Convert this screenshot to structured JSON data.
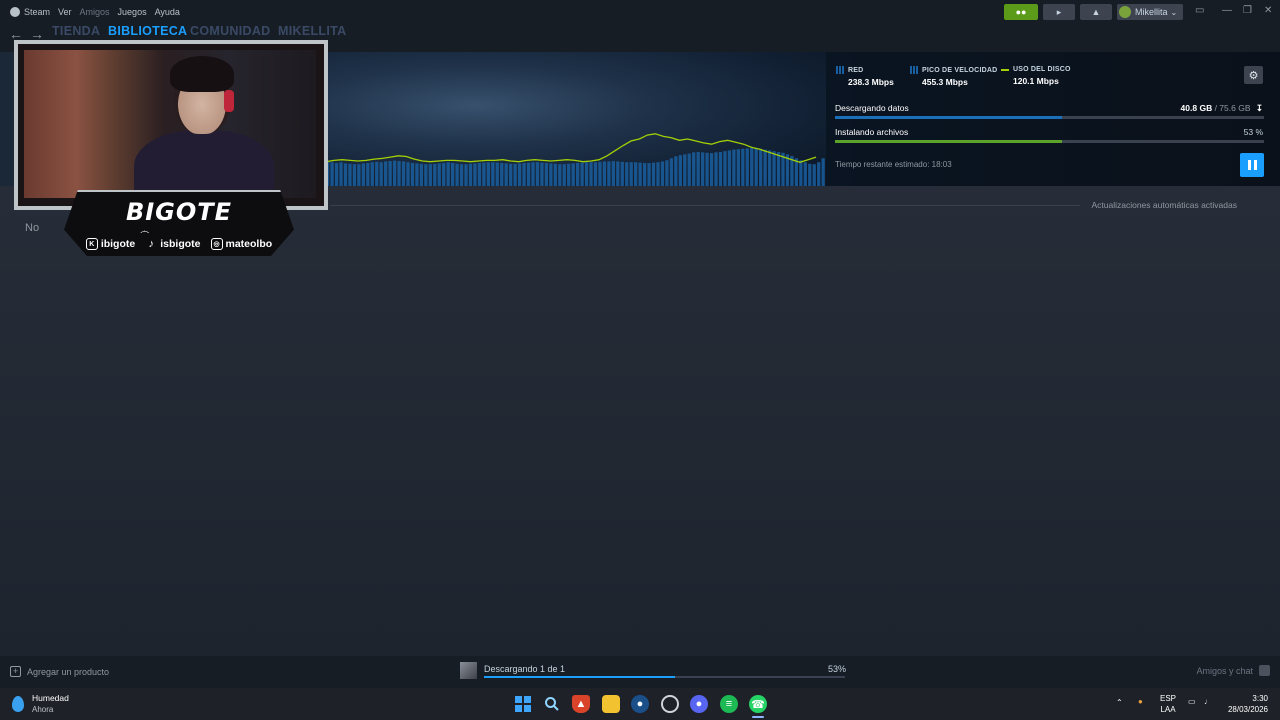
{
  "menubar": {
    "app": "Steam",
    "items": [
      "Ver",
      "Amigos",
      "Juegos",
      "Ayuda"
    ],
    "account_name": "Mikellita",
    "account_caret": "⌄"
  },
  "nav": {
    "back_arrow": "←",
    "forward_arrow": "→",
    "tabs": [
      "TIENDA",
      "BIBLIOTECA",
      "COMUNIDAD",
      "MIKELLITA"
    ],
    "active_tab": "BIBLIOTECA"
  },
  "downloads": {
    "stats": [
      {
        "label": "RED",
        "value": "238.3 Mbps",
        "legend": "bars"
      },
      {
        "label": "PICO DE VELOCIDAD",
        "value": "455.3 Mbps",
        "legend": "bars"
      },
      {
        "label": "USO DEL DISCO",
        "value": "120.1 Mbps",
        "legend": "line"
      }
    ],
    "downloading_label": "Descargando datos",
    "downloaded_amount": "40.8 GB",
    "total_amount": "/ 75.6 GB",
    "download_progress": 0.53,
    "installing_label": "Instalando archivos",
    "install_percent": "53 %",
    "install_progress": 0.53,
    "eta": "Tiempo restante estimado: 18:03",
    "auto_updates": "Actualizaciones automáticas activadas",
    "partial_text": "No",
    "graph": {
      "network_bars": [
        0.62,
        0.6,
        0.58,
        0.6,
        0.57,
        0.56,
        0.55,
        0.55,
        0.57,
        0.58,
        0.6,
        0.61,
        0.6,
        0.62,
        0.63,
        0.64,
        0.63,
        0.62,
        0.6,
        0.58,
        0.57,
        0.56,
        0.55,
        0.55,
        0.56,
        0.57,
        0.58,
        0.6,
        0.58,
        0.56,
        0.55,
        0.55,
        0.56,
        0.57,
        0.58,
        0.59,
        0.6,
        0.6,
        0.59,
        0.58,
        0.57,
        0.56,
        0.56,
        0.57,
        0.58,
        0.59,
        0.6,
        0.6,
        0.59,
        0.58,
        0.57,
        0.56,
        0.55,
        0.55,
        0.56,
        0.57,
        0.58,
        0.59,
        0.6,
        0.6,
        0.6,
        0.61,
        0.62,
        0.62,
        0.63,
        0.62,
        0.61,
        0.6,
        0.6,
        0.6,
        0.59,
        0.58,
        0.58,
        0.59,
        0.6,
        0.62,
        0.65,
        0.7,
        0.75,
        0.78,
        0.8,
        0.82,
        0.85,
        0.86,
        0.85,
        0.84,
        0.83,
        0.85,
        0.86,
        0.88,
        0.9,
        0.92,
        0.93,
        0.94,
        0.95,
        0.96,
        0.95,
        0.94,
        0.92,
        0.9,
        0.88,
        0.86,
        0.84,
        0.8,
        0.76,
        0.7,
        0.65,
        0.6,
        0.56,
        0.55,
        0.6,
        0.7
      ],
      "disk_line": [
        0.53,
        0.55,
        0.56,
        0.55,
        0.54,
        0.55,
        0.57,
        0.58,
        0.6,
        0.62,
        0.61,
        0.57,
        0.54,
        0.53,
        0.54,
        0.55,
        0.55,
        0.54,
        0.53,
        0.54,
        0.55,
        0.55,
        0.56,
        0.54,
        0.53,
        0.55,
        0.56,
        0.55,
        0.54,
        0.55,
        0.56,
        0.55,
        0.53,
        0.54,
        0.56,
        0.62,
        0.7,
        0.78,
        0.85,
        0.88,
        0.94,
        0.96,
        0.92,
        0.9,
        0.86,
        0.88,
        0.85,
        0.82,
        0.8,
        0.84,
        0.86,
        0.83,
        0.8,
        0.75,
        0.72,
        0.68,
        0.64,
        0.6,
        0.56,
        0.52,
        0.56,
        0.6
      ]
    }
  },
  "webcam": {
    "brand": "BIGOTE",
    "mustache": "෴",
    "socials": [
      {
        "icon": "twitch-kick-icon",
        "glyph": "K",
        "handle": "ibigote"
      },
      {
        "icon": "tiktok-icon",
        "glyph": "♪",
        "handle": "isbigote"
      },
      {
        "icon": "instagram-icon",
        "glyph": "◎",
        "handle": "mateolbo"
      }
    ]
  },
  "bottombar": {
    "add_product": "Agregar un producto",
    "downloading_status": "Descargando 1 de 1",
    "percent": "53%",
    "progress": 0.53,
    "friends_chat": "Amigos y chat"
  },
  "taskbar": {
    "weather_title": "Humedad",
    "weather_sub": "Ahora",
    "lang_top": "ESP",
    "lang_bottom": "LAA",
    "time": "3:30",
    "date": "28/03/2026",
    "tray_caret": "⌃"
  },
  "colors": {
    "accent": "#1a9fff",
    "disk_line": "#a4d007",
    "network_bar": "#1a5fa0",
    "install_fill": "#5ba32b",
    "friends_green": "#5c9a1a"
  }
}
